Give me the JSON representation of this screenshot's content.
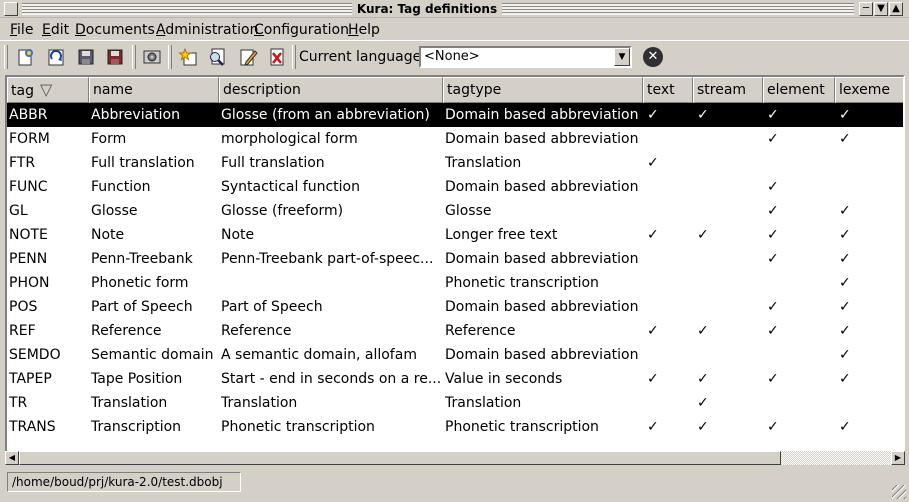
{
  "window": {
    "title": "Kura: Tag definitions"
  },
  "menu": [
    {
      "label": "File",
      "u": "F",
      "rest": "ile"
    },
    {
      "label": "Edit",
      "u": "E",
      "rest": "dit"
    },
    {
      "label": "Documents",
      "u": "D",
      "rest": "ocuments"
    },
    {
      "label": "Administration",
      "u": "A",
      "rest": "dministration"
    },
    {
      "label": "Configuration",
      "u": "C",
      "rest": "onfiguration"
    },
    {
      "label": "Help",
      "u": "H",
      "rest": "elp"
    }
  ],
  "toolbar": {
    "icons": [
      "new-icon",
      "reload-icon",
      "save-icon",
      "save-all-icon",
      "settings-icon",
      "new-tag-icon",
      "find-icon",
      "edit-icon",
      "delete-icon",
      "clear-icon"
    ],
    "language_label": "Current language:",
    "language_value": "<None>"
  },
  "table": {
    "columns": [
      "tag",
      "name",
      "description",
      "tagtype",
      "text",
      "stream",
      "element",
      "lexeme"
    ],
    "sort_column": "tag",
    "selected_row": 0,
    "rows": [
      {
        "tag": "ABBR",
        "name": "Abbreviation",
        "description": "Glosse (from an abbreviation)",
        "tagtype": "Domain based abbreviation",
        "text": "✓",
        "stream": "✓",
        "element": "✓",
        "lexeme": "✓"
      },
      {
        "tag": "FORM",
        "name": "Form",
        "description": "morphological form",
        "tagtype": "Domain based abbreviation",
        "text": "",
        "stream": "",
        "element": "✓",
        "lexeme": "✓"
      },
      {
        "tag": "FTR",
        "name": "Full translation",
        "description": "Full translation",
        "tagtype": "Translation",
        "text": "✓",
        "stream": "",
        "element": "",
        "lexeme": ""
      },
      {
        "tag": "FUNC",
        "name": "Function",
        "description": "Syntactical function",
        "tagtype": "Domain based abbreviation",
        "text": "",
        "stream": "",
        "element": "✓",
        "lexeme": ""
      },
      {
        "tag": "GL",
        "name": "Glosse",
        "description": "Glosse (freeform)",
        "tagtype": "Glosse",
        "text": "",
        "stream": "",
        "element": "✓",
        "lexeme": "✓"
      },
      {
        "tag": "NOTE",
        "name": "Note",
        "description": "Note",
        "tagtype": "Longer free text",
        "text": "✓",
        "stream": "✓",
        "element": "✓",
        "lexeme": "✓"
      },
      {
        "tag": "PENN",
        "name": "Penn-Treebank",
        "description": "Penn-Treebank part-of-speec...",
        "tagtype": "Domain based abbreviation",
        "text": "",
        "stream": "",
        "element": "✓",
        "lexeme": "✓"
      },
      {
        "tag": "PHON",
        "name": "Phonetic form",
        "description": "",
        "tagtype": "Phonetic transcription",
        "text": "",
        "stream": "",
        "element": "",
        "lexeme": "✓"
      },
      {
        "tag": "POS",
        "name": "Part of Speech",
        "description": "Part of Speech",
        "tagtype": "Domain based abbreviation",
        "text": "",
        "stream": "",
        "element": "✓",
        "lexeme": "✓"
      },
      {
        "tag": "REF",
        "name": "Reference",
        "description": "Reference",
        "tagtype": "Reference",
        "text": "✓",
        "stream": "✓",
        "element": "✓",
        "lexeme": "✓"
      },
      {
        "tag": "SEMDO",
        "name": "Semantic domain",
        "description": "A semantic domain, allofam",
        "tagtype": "Domain based abbreviation",
        "text": "",
        "stream": "",
        "element": "",
        "lexeme": "✓"
      },
      {
        "tag": "TAPEP",
        "name": "Tape Position",
        "description": "Start - end in seconds on a re...",
        "tagtype": "Value in seconds",
        "text": "✓",
        "stream": "✓",
        "element": "✓",
        "lexeme": "✓"
      },
      {
        "tag": "TR",
        "name": "Translation",
        "description": "Translation",
        "tagtype": "Translation",
        "text": "",
        "stream": "✓",
        "element": "",
        "lexeme": ""
      },
      {
        "tag": "TRANS",
        "name": "Transcription",
        "description": "Phonetic transcription",
        "tagtype": "Phonetic transcription",
        "text": "✓",
        "stream": "✓",
        "element": "✓",
        "lexeme": "✓"
      }
    ]
  },
  "status": {
    "path": "/home/boud/prj/kura-2.0/test.dbobj"
  }
}
